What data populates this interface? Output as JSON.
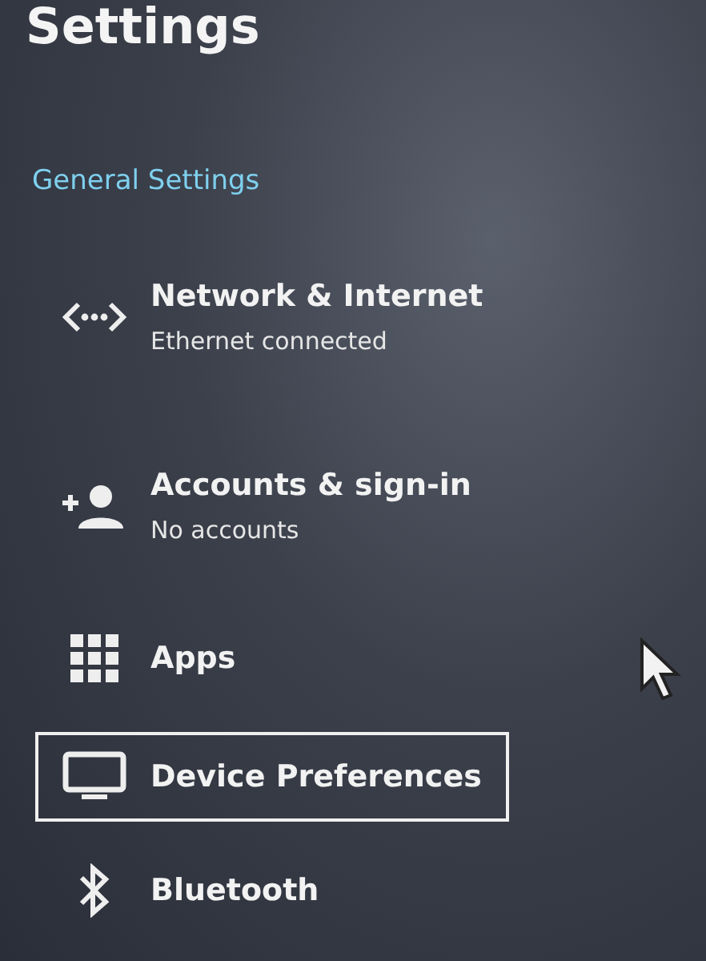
{
  "title": "Settings",
  "section": "General Settings",
  "items": [
    {
      "title": "Network & Internet",
      "subtitle": "Ethernet connected",
      "selected": false
    },
    {
      "title": "Accounts & sign-in",
      "subtitle": "No accounts",
      "selected": false
    },
    {
      "title": "Apps",
      "selected": false
    },
    {
      "title": "Device Preferences",
      "selected": true
    },
    {
      "title": "Bluetooth",
      "selected": false
    }
  ]
}
